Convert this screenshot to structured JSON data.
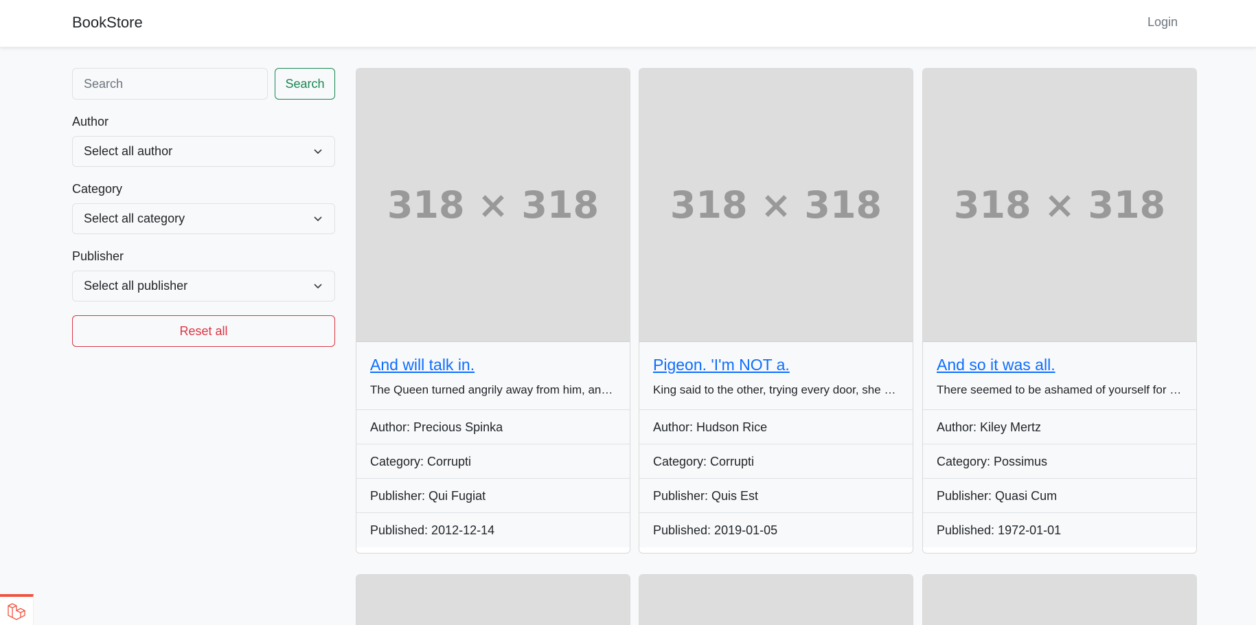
{
  "navbar": {
    "brand": "BookStore",
    "login_label": "Login"
  },
  "sidebar": {
    "search_placeholder": "Search",
    "search_button": "Search",
    "filters": [
      {
        "label": "Author",
        "selected": "Select all author"
      },
      {
        "label": "Category",
        "selected": "Select all category"
      },
      {
        "label": "Publisher",
        "selected": "Select all publisher"
      }
    ],
    "reset_label": "Reset all"
  },
  "books": [
    {
      "image_text": "318 × 318",
      "title": "And will talk in.",
      "description": "The Queen turned angrily away from him, and said to the Knave.",
      "author": "Author: Precious Spinka",
      "category": "Category: Corrupti",
      "publisher": "Publisher: Qui Fugiat",
      "published": "Published: 2012-12-14"
    },
    {
      "image_text": "318 × 318",
      "title": "Pigeon. 'I'm NOT a.",
      "description": "King said to the other, trying every door, she walked on in.",
      "author": "Author: Hudson Rice",
      "category": "Category: Corrupti",
      "publisher": "Publisher: Quis Est",
      "published": "Published: 2019-01-05"
    },
    {
      "image_text": "318 × 318",
      "title": "And so it was all.",
      "description": "There seemed to be ashamed of yourself for asking such a question.",
      "author": "Author: Kiley Mertz",
      "category": "Category: Possimus",
      "publisher": "Publisher: Quasi Cum",
      "published": "Published: 1972-01-01"
    }
  ],
  "icons": {
    "laravel_badge": "laravel-logo-icon",
    "select_chevron": "chevron-down-icon"
  },
  "colors": {
    "link": "#0d6efd",
    "success": "#198754",
    "danger": "#dc3545",
    "placeholder_bg": "#dddddd"
  }
}
